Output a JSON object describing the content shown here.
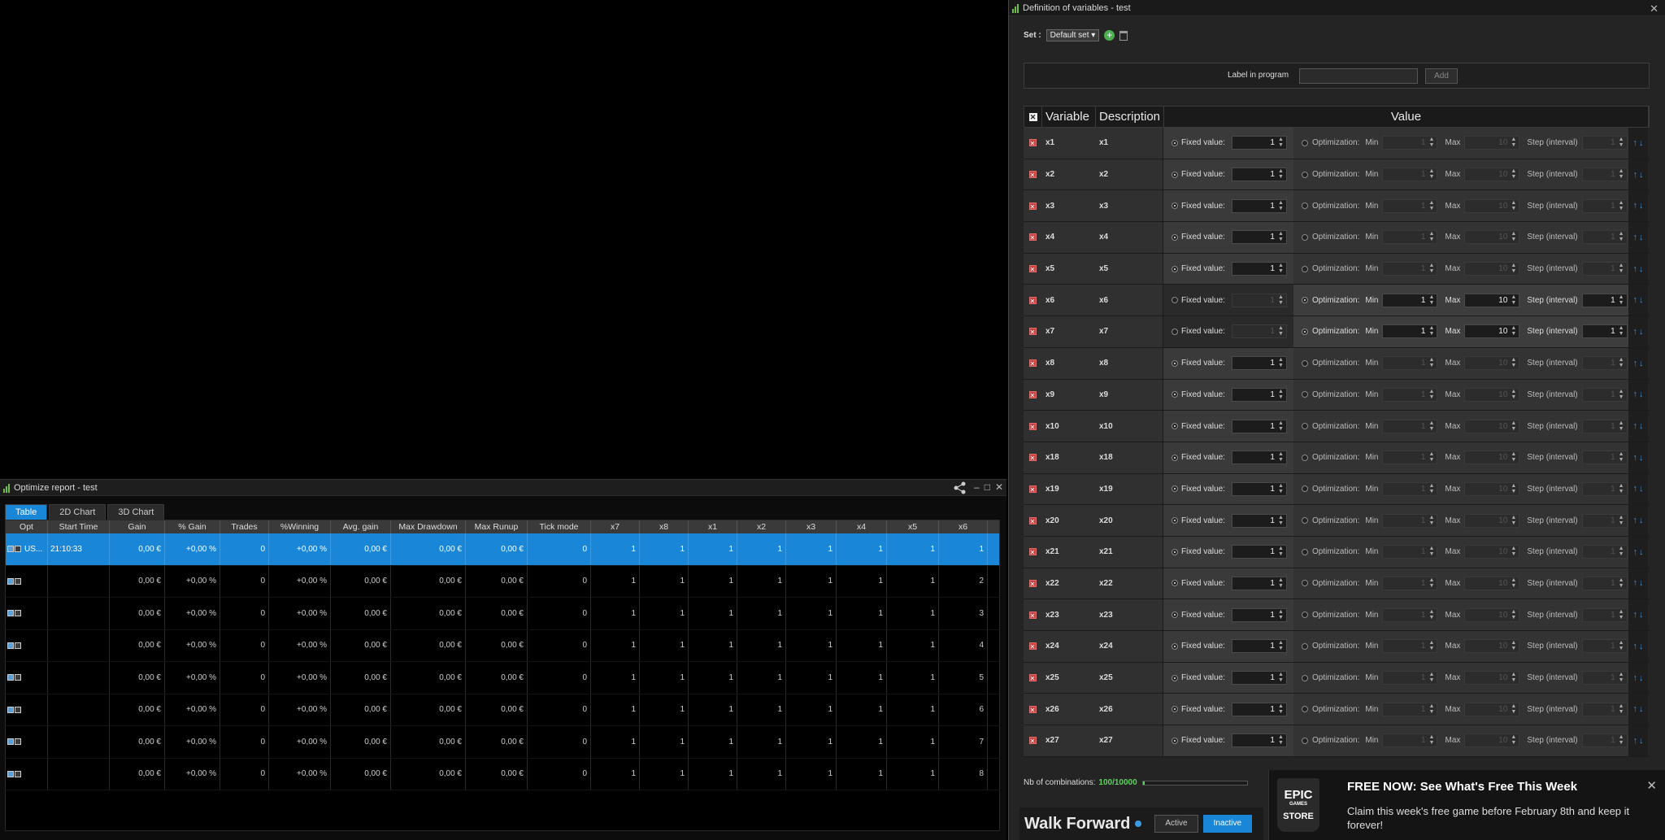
{
  "report": {
    "title": "Optimize report - test",
    "tabs": [
      {
        "label": "Table"
      },
      {
        "label": "2D Chart"
      },
      {
        "label": "3D Chart"
      }
    ],
    "columns": [
      "Opt",
      "Start Time",
      "Gain",
      "% Gain",
      "Trades",
      "%Winning",
      "Avg. gain",
      "Max Drawdown",
      "Max Runup",
      "Tick mode",
      "x7",
      "x8",
      "x1",
      "x2",
      "x3",
      "x4",
      "x5",
      "x6"
    ],
    "rows": [
      {
        "name": "US...",
        "start": "21:10:33",
        "gain": "0,00 €",
        "pgain": "+0,00 %",
        "trades": "0",
        "win": "+0,00 %",
        "avg": "0,00 €",
        "dd": "0,00 €",
        "runup": "0,00 €",
        "tick": "0",
        "x7": "1",
        "x8": "1",
        "x1": "1",
        "x2": "1",
        "x3": "1",
        "x4": "1",
        "x5": "1",
        "x6": "1"
      },
      {
        "name": "",
        "start": "",
        "gain": "0,00 €",
        "pgain": "+0,00 %",
        "trades": "0",
        "win": "+0,00 %",
        "avg": "0,00 €",
        "dd": "0,00 €",
        "runup": "0,00 €",
        "tick": "0",
        "x7": "1",
        "x8": "1",
        "x1": "1",
        "x2": "1",
        "x3": "1",
        "x4": "1",
        "x5": "1",
        "x6": "2"
      },
      {
        "name": "",
        "start": "",
        "gain": "0,00 €",
        "pgain": "+0,00 %",
        "trades": "0",
        "win": "+0,00 %",
        "avg": "0,00 €",
        "dd": "0,00 €",
        "runup": "0,00 €",
        "tick": "0",
        "x7": "1",
        "x8": "1",
        "x1": "1",
        "x2": "1",
        "x3": "1",
        "x4": "1",
        "x5": "1",
        "x6": "3"
      },
      {
        "name": "",
        "start": "",
        "gain": "0,00 €",
        "pgain": "+0,00 %",
        "trades": "0",
        "win": "+0,00 %",
        "avg": "0,00 €",
        "dd": "0,00 €",
        "runup": "0,00 €",
        "tick": "0",
        "x7": "1",
        "x8": "1",
        "x1": "1",
        "x2": "1",
        "x3": "1",
        "x4": "1",
        "x5": "1",
        "x6": "4"
      },
      {
        "name": "",
        "start": "",
        "gain": "0,00 €",
        "pgain": "+0,00 %",
        "trades": "0",
        "win": "+0,00 %",
        "avg": "0,00 €",
        "dd": "0,00 €",
        "runup": "0,00 €",
        "tick": "0",
        "x7": "1",
        "x8": "1",
        "x1": "1",
        "x2": "1",
        "x3": "1",
        "x4": "1",
        "x5": "1",
        "x6": "5"
      },
      {
        "name": "",
        "start": "",
        "gain": "0,00 €",
        "pgain": "+0,00 %",
        "trades": "0",
        "win": "+0,00 %",
        "avg": "0,00 €",
        "dd": "0,00 €",
        "runup": "0,00 €",
        "tick": "0",
        "x7": "1",
        "x8": "1",
        "x1": "1",
        "x2": "1",
        "x3": "1",
        "x4": "1",
        "x5": "1",
        "x6": "6"
      },
      {
        "name": "",
        "start": "",
        "gain": "0,00 €",
        "pgain": "+0,00 %",
        "trades": "0",
        "win": "+0,00 %",
        "avg": "0,00 €",
        "dd": "0,00 €",
        "runup": "0,00 €",
        "tick": "0",
        "x7": "1",
        "x8": "1",
        "x1": "1",
        "x2": "1",
        "x3": "1",
        "x4": "1",
        "x5": "1",
        "x6": "7"
      },
      {
        "name": "",
        "start": "",
        "gain": "0,00 €",
        "pgain": "+0,00 %",
        "trades": "0",
        "win": "+0,00 %",
        "avg": "0,00 €",
        "dd": "0,00 €",
        "runup": "0,00 €",
        "tick": "0",
        "x7": "1",
        "x8": "1",
        "x1": "1",
        "x2": "1",
        "x3": "1",
        "x4": "1",
        "x5": "1",
        "x6": "8"
      }
    ]
  },
  "defwin": {
    "title": "Definition of variables - test",
    "set_label": "Set :",
    "set_value": "Default set",
    "label_in_program": "Label in program",
    "add_label": "Add",
    "headers": {
      "variable": "Variable",
      "description": "Description",
      "value": "Value"
    },
    "fixed_label": "Fixed value:",
    "opt_label": "Optimization:",
    "min_label": "Min",
    "max_label": "Max",
    "step_label": "Step (interval)",
    "variables": [
      {
        "name": "x1",
        "desc": "x1",
        "opt": false,
        "fixed": "1",
        "min": "1",
        "max": "10",
        "step": "1"
      },
      {
        "name": "x2",
        "desc": "x2",
        "opt": false,
        "fixed": "1",
        "min": "1",
        "max": "10",
        "step": "1"
      },
      {
        "name": "x3",
        "desc": "x3",
        "opt": false,
        "fixed": "1",
        "min": "1",
        "max": "10",
        "step": "1"
      },
      {
        "name": "x4",
        "desc": "x4",
        "opt": false,
        "fixed": "1",
        "min": "1",
        "max": "10",
        "step": "1"
      },
      {
        "name": "x5",
        "desc": "x5",
        "opt": false,
        "fixed": "1",
        "min": "1",
        "max": "10",
        "step": "1"
      },
      {
        "name": "x6",
        "desc": "x6",
        "opt": true,
        "fixed": "1",
        "min": "1",
        "max": "10",
        "step": "1"
      },
      {
        "name": "x7",
        "desc": "x7",
        "opt": true,
        "fixed": "1",
        "min": "1",
        "max": "10",
        "step": "1"
      },
      {
        "name": "x8",
        "desc": "x8",
        "opt": false,
        "fixed": "1",
        "min": "1",
        "max": "10",
        "step": "1"
      },
      {
        "name": "x9",
        "desc": "x9",
        "opt": false,
        "fixed": "1",
        "min": "1",
        "max": "10",
        "step": "1"
      },
      {
        "name": "x10",
        "desc": "x10",
        "opt": false,
        "fixed": "1",
        "min": "1",
        "max": "10",
        "step": "1"
      },
      {
        "name": "x18",
        "desc": "x18",
        "opt": false,
        "fixed": "1",
        "min": "1",
        "max": "10",
        "step": "1"
      },
      {
        "name": "x19",
        "desc": "x19",
        "opt": false,
        "fixed": "1",
        "min": "1",
        "max": "10",
        "step": "1"
      },
      {
        "name": "x20",
        "desc": "x20",
        "opt": false,
        "fixed": "1",
        "min": "1",
        "max": "10",
        "step": "1"
      },
      {
        "name": "x21",
        "desc": "x21",
        "opt": false,
        "fixed": "1",
        "min": "1",
        "max": "10",
        "step": "1"
      },
      {
        "name": "x22",
        "desc": "x22",
        "opt": false,
        "fixed": "1",
        "min": "1",
        "max": "10",
        "step": "1"
      },
      {
        "name": "x23",
        "desc": "x23",
        "opt": false,
        "fixed": "1",
        "min": "1",
        "max": "10",
        "step": "1"
      },
      {
        "name": "x24",
        "desc": "x24",
        "opt": false,
        "fixed": "1",
        "min": "1",
        "max": "10",
        "step": "1"
      },
      {
        "name": "x25",
        "desc": "x25",
        "opt": false,
        "fixed": "1",
        "min": "1",
        "max": "10",
        "step": "1"
      },
      {
        "name": "x26",
        "desc": "x26",
        "opt": false,
        "fixed": "1",
        "min": "1",
        "max": "10",
        "step": "1"
      },
      {
        "name": "x27",
        "desc": "x27",
        "opt": false,
        "fixed": "1",
        "min": "1",
        "max": "10",
        "step": "1"
      }
    ],
    "combinations_label": "Nb of combinations:",
    "combinations_value": "100/10000",
    "combinations_fraction": 0.01,
    "walk_forward": {
      "title": "Walk Forward",
      "active": "Active",
      "inactive": "Inactive"
    }
  },
  "epic": {
    "logo_top": "EPIC",
    "logo_mid": "GAMES",
    "logo_bottom": "STORE",
    "title": "FREE NOW: See What's Free This Week",
    "body": "Claim this week's free game before February 8th and keep it forever!"
  },
  "colors": {
    "accent": "#1a86d8",
    "logo_green": "#6fbf4a",
    "combinations_green": "#5fd35f",
    "delete_red": "#c84040"
  },
  "icons": [
    "app-logo-icon",
    "share-icon",
    "minimize-icon",
    "maximize-icon",
    "close-icon",
    "add-set-icon",
    "trash-icon",
    "delete-variable-icon",
    "move-up-icon",
    "move-down-icon",
    "info-dot-icon",
    "epic-close-icon"
  ]
}
